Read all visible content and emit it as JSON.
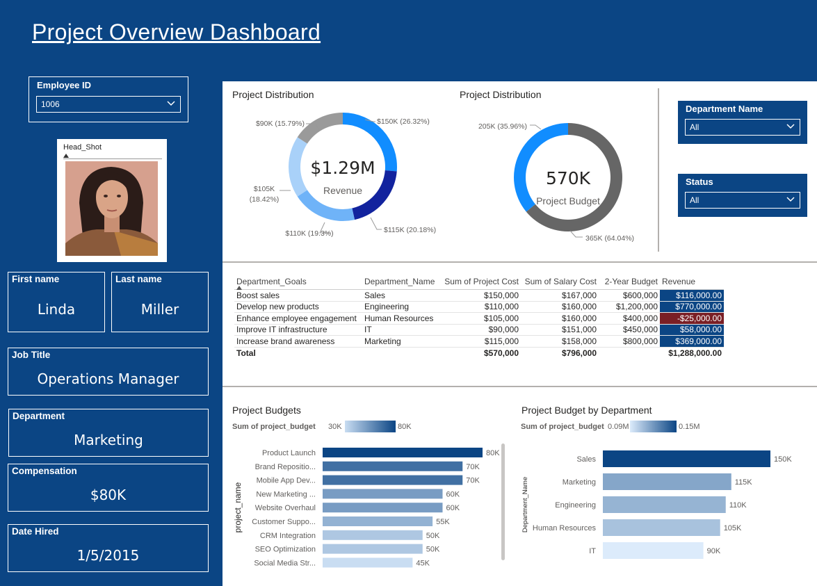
{
  "header": {
    "title": "Project Overview Dashboard"
  },
  "employee_slicer": {
    "label": "Employee ID",
    "value": "1006"
  },
  "headshot": {
    "label": "Head_Shot"
  },
  "cards": {
    "first_name": {
      "label": "First name",
      "value": "Linda"
    },
    "last_name": {
      "label": "Last name",
      "value": "Miller"
    },
    "job_title": {
      "label": "Job Title",
      "value": "Operations Manager"
    },
    "department": {
      "label": "Department",
      "value": "Marketing"
    },
    "compensation": {
      "label": "Compensation",
      "value": "$80K"
    },
    "date_hired": {
      "label": "Date Hired",
      "value": "1/5/2015"
    }
  },
  "filters": {
    "department_name": {
      "label": "Department Name",
      "value": "All"
    },
    "status": {
      "label": "Status",
      "value": "All"
    }
  },
  "donut_revenue": {
    "title": "Project Distribution",
    "center_value": "$1.29M",
    "center_label": "Revenue",
    "slices": [
      {
        "value": 150,
        "label": "$150K (26.32%)",
        "color": "#118dff"
      },
      {
        "value": 115,
        "label": "$115K (20.18%)",
        "color": "#12239e"
      },
      {
        "value": 110,
        "label": "$110K (19.3%)",
        "color": "#6fb3f8"
      },
      {
        "value": 105,
        "label1": "$105K",
        "label2": "(18.42%)",
        "color": "#a9d1f9"
      },
      {
        "value": 90,
        "label": "$90K (15.79%)",
        "color": "#9a9a9a"
      }
    ]
  },
  "donut_budget": {
    "title": "Project Distribution",
    "center_value": "570K",
    "center_label": "Project Budget",
    "slices": [
      {
        "value": 365,
        "label": "365K (64.04%)",
        "color": "#666666"
      },
      {
        "value": 205,
        "label": "205K (35.96%)",
        "color": "#118dff"
      }
    ]
  },
  "table": {
    "headers": [
      "Department_Goals",
      "Department_Name",
      "Sum of Project Cost",
      "Sum of Salary Cost",
      "2-Year Budget",
      "Revenue"
    ],
    "rows": [
      [
        "Boost sales",
        "Sales",
        "$150,000",
        "$167,000",
        "$600,000",
        "$116,000.00"
      ],
      [
        "Develop new products",
        "Engineering",
        "$110,000",
        "$160,000",
        "$1,200,000",
        "$770,000.00"
      ],
      [
        "Enhance employee engagement",
        "Human Resources",
        "$105,000",
        "$160,000",
        "$400,000",
        "-$25,000.00"
      ],
      [
        "Improve IT infrastructure",
        "IT",
        "$90,000",
        "$151,000",
        "$450,000",
        "$58,000.00"
      ],
      [
        "Increase brand awareness",
        "Marketing",
        "$115,000",
        "$158,000",
        "$800,000",
        "$369,000.00"
      ]
    ],
    "total": [
      "Total",
      "",
      "$570,000",
      "$796,000",
      "",
      "$1,288,000.00"
    ]
  },
  "bar_projects": {
    "title": "Project Budgets",
    "legend_label": "Sum of project_budget",
    "legend_min": "30K",
    "legend_max": "80K",
    "axis_label": "project_name",
    "chart_data": {
      "type": "bar",
      "categories": [
        "Product Launch",
        "Brand Repositio...",
        "Mobile App Dev...",
        "New Marketing ...",
        "Website Overhaul",
        "Customer Suppo...",
        "CRM Integration",
        "SEO Optimization",
        "Social Media Str..."
      ],
      "values": [
        80,
        70,
        70,
        60,
        60,
        55,
        50,
        50,
        45
      ],
      "labels": [
        "80K",
        "70K",
        "70K",
        "60K",
        "60K",
        "55K",
        "50K",
        "50K",
        "45K"
      ],
      "xlim": [
        0,
        80
      ],
      "color_low": "#c9ddf2",
      "color_high": "#0b4584"
    }
  },
  "bar_departments": {
    "title": "Project Budget by Department",
    "legend_label": "Sum of project_budget",
    "legend_min": "0.09M",
    "legend_max": "0.15M",
    "axis_label": "Department_Name",
    "chart_data": {
      "type": "bar",
      "categories": [
        "Sales",
        "Marketing",
        "Engineering",
        "Human Resources",
        "IT"
      ],
      "values": [
        150,
        115,
        110,
        105,
        90
      ],
      "labels": [
        "150K",
        "115K",
        "110K",
        "105K",
        "90K"
      ],
      "xlim": [
        0,
        150
      ],
      "color_low": "#dcebfb",
      "color_high": "#0b4584"
    }
  }
}
